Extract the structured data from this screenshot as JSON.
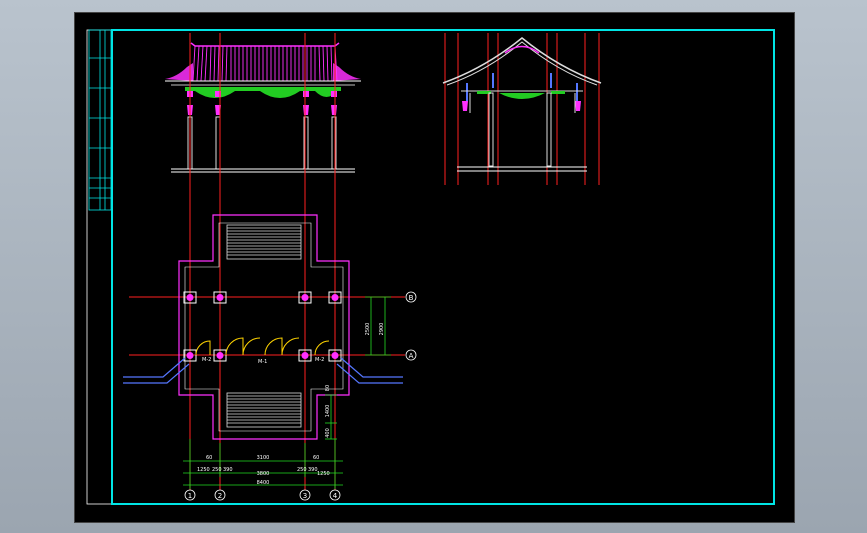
{
  "colors": {
    "background": "#000000",
    "frame": "#00e5e5",
    "axis": "#ff2020",
    "roof": "#ff30ff",
    "bracket": "#22cc22",
    "column": "#dddddd",
    "dimension": "#22dd22",
    "label": "#ffffff"
  },
  "plan": {
    "axis_labels": {
      "col1": "1",
      "col2": "2",
      "col3": "3",
      "col4": "4",
      "rowA": "A",
      "rowB": "B"
    },
    "door_labels": {
      "left": "M-2",
      "center": "M-1",
      "right": "M-2"
    },
    "dim_top_row": {
      "d60a": "60",
      "d250a": "250",
      "d3100": "3100",
      "d250b": "250",
      "d60b": "60"
    },
    "dim_mid_row": {
      "d1250a": "1250",
      "d390a": "390",
      "d3800": "3800",
      "d390b": "390",
      "d1250b": "1250"
    },
    "dim_total": "8400",
    "dim_right": {
      "d2500": "2500",
      "d2900": "2900",
      "d1400": "1400",
      "d400": "400",
      "d80": "80"
    }
  }
}
